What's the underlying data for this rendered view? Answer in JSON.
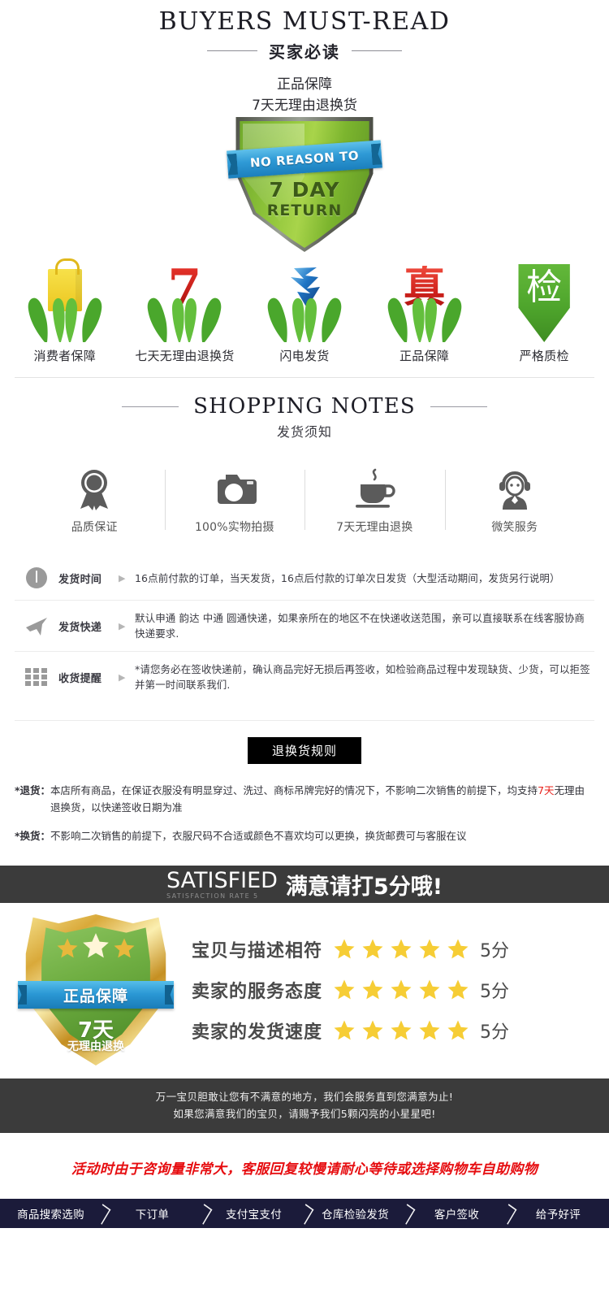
{
  "header": {
    "title_en": "BUYERS MUST-READ",
    "title_cn": "买家必读",
    "sub_line1": "正品保障",
    "sub_line2": "7天无理由退换货"
  },
  "shield_badge": {
    "ribbon": "NO REASON TO",
    "line1": "7 DAY",
    "line2": "RETURN",
    "color_green": "#8ec43a",
    "color_ribbon": "#2f9ad6"
  },
  "guarantee_icons": [
    {
      "glyph": "bag",
      "label": "消费者保障"
    },
    {
      "glyph": "7",
      "label": "七天无理由退换货"
    },
    {
      "glyph": "bolt",
      "label": "闪电发货"
    },
    {
      "glyph": "真",
      "label": "正品保障"
    },
    {
      "glyph": "检",
      "label": "严格质检"
    }
  ],
  "shopping_notes": {
    "title_en": "SHOPPING NOTES",
    "title_cn": "发货须知",
    "services": [
      {
        "icon": "medal-icon",
        "label": "品质保证"
      },
      {
        "icon": "camera-icon",
        "label": "100%实物拍摄"
      },
      {
        "icon": "coffee-cup-icon",
        "label": "7天无理由退换"
      },
      {
        "icon": "headset-agent-icon",
        "label": "微笑服务"
      }
    ],
    "info_rows": [
      {
        "icon": "clock-icon",
        "key": "发货时间",
        "arrow": "▶",
        "value": "16点前付款的订单，当天发货，16点后付款的订单次日发货（大型活动期间，发货另行说明）"
      },
      {
        "icon": "airplane-icon",
        "key": "发货快递",
        "arrow": "▶",
        "value": "默认申通 韵达 中通 圆通快递，如果亲所在的地区不在快递收送范围，亲可以直接联系在线客服协商快递要求."
      },
      {
        "icon": "grid-icon",
        "key": "收货提醒",
        "arrow": "▶",
        "value": "*请您务必在签收快递前，确认商品完好无损后再签收，如检验商品过程中发现缺货、少货，可以拒签并第一时间联系我们."
      }
    ]
  },
  "return_rules": {
    "badge": "退换货规则",
    "items": [
      {
        "tag": "*退货：",
        "text_before": "本店所有商品，在保证衣服没有明显穿过、洗过、商标吊牌完好的情况下，不影响二次销售的前提下，均支持",
        "highlight": "7天",
        "text_after": "无理由退换货，以快递签收日期为准"
      },
      {
        "tag": "*换货：",
        "text_before": "不影响二次销售的前提下，衣服尺码不合适或颜色不喜欢均可以更换，换货邮费可与客服在议",
        "highlight": "",
        "text_after": ""
      }
    ]
  },
  "satisfied": {
    "banner_en": "SATISFIED",
    "banner_en_sub": "SATISFACTION RATE 5",
    "banner_cn": "满意请打5分哦!",
    "gold_shield": {
      "ribbon": "正品保障",
      "days": "7天",
      "sub": "无理由退换",
      "stars": 3
    },
    "ratings": [
      {
        "label": "宝贝与描述相符",
        "stars": 5,
        "score": "5分"
      },
      {
        "label": "卖家的服务态度",
        "stars": 5,
        "score": "5分"
      },
      {
        "label": "卖家的发货速度",
        "stars": 5,
        "score": "5分"
      }
    ],
    "note_line1": "万一宝贝胆敢让您有不满意的地方，我们会服务直到您满意为止!",
    "note_line2": "如果您满意我们的宝贝，请赐予我们5颗闪亮的小星星吧!"
  },
  "red_notice": "活动时由于咨询量非常大，客服回复较慢请耐心等待或选择购物车自助购物",
  "process_steps": [
    "商品搜索选购",
    "下订单",
    "支付宝支付",
    "仓库检验发货",
    "客户签收",
    "给予好评"
  ]
}
